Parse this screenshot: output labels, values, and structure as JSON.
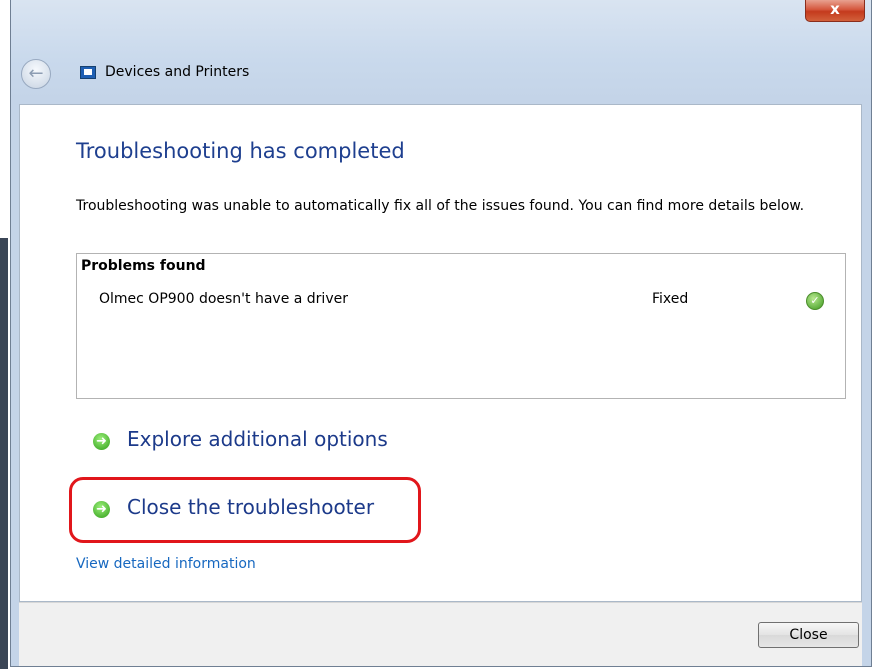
{
  "window": {
    "title": "Devices and Printers",
    "close_glyph": "x"
  },
  "main": {
    "heading": "Troubleshooting has completed",
    "description": "Troubleshooting was unable to automatically fix all of the issues found. You can find more details below.",
    "problems": {
      "title": "Problems found",
      "items": [
        {
          "name": "Olmec OP900 doesn't have a driver",
          "status": "Fixed",
          "icon": "check-circle-icon"
        }
      ]
    },
    "options": [
      {
        "label": "Explore additional options",
        "icon": "green-arrow-icon"
      },
      {
        "label": "Close the troubleshooter",
        "icon": "green-arrow-icon",
        "highlighted": true
      }
    ],
    "detail_link": "View detailed information"
  },
  "footer": {
    "close_label": "Close"
  },
  "colors": {
    "heading": "#1e3f8f",
    "link": "#1768c0",
    "highlight": "#e1161b"
  }
}
